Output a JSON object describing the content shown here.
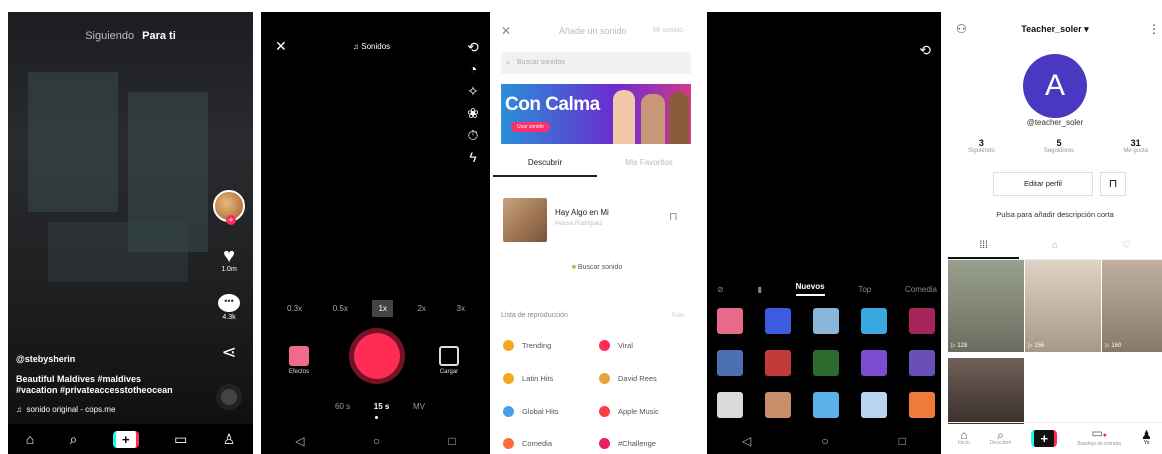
{
  "feed": {
    "tab_following": "Siguiendo",
    "tab_foryou": "Para ti",
    "likes": "1.0m",
    "comments": "4.3k",
    "username": "@stebysherin",
    "caption_line1": "Beautiful Maldives #maldives",
    "caption_line2": "#vacation #privateaccesstotheocean",
    "sound": "sonido original - cops.me"
  },
  "camera": {
    "sounds_label": "Sonidos",
    "speeds": [
      "0.3x",
      "0.5x",
      "1x",
      "2x",
      "3x"
    ],
    "selected_speed": "1x",
    "effects_label": "Efectos",
    "upload_label": "Cargar",
    "modes": [
      "60 s",
      "15 s",
      "MV"
    ],
    "selected_mode": "15 s"
  },
  "sounds": {
    "title": "Añade un sonido",
    "my_sounds": "Mi sonido",
    "search_placeholder": "Buscar sonidos",
    "banner_title": "Con Calma",
    "banner_button": "Usar sonido",
    "tab_discover": "Descubrir",
    "tab_favorites": "Mis Favoritos",
    "song_title": "Hay Algo en Mi",
    "song_artist": "Pelusa Rodriguez",
    "search_more": "Buscar sonido",
    "playlist_header": "Lista de reproducción",
    "playlist_all": "Todo",
    "playlists": [
      {
        "name": "Trending",
        "color": "#f5a623"
      },
      {
        "name": "Viral",
        "color": "#fe2c55"
      },
      {
        "name": "Latin Hits",
        "color": "#f5a623"
      },
      {
        "name": "David Rees",
        "color": "#e9a23b"
      },
      {
        "name": "Global Hits",
        "color": "#4a9fe8"
      },
      {
        "name": "Apple Music",
        "color": "#fc3c44"
      },
      {
        "name": "Comedia",
        "color": "#ff6b3d"
      },
      {
        "name": "#Challenge",
        "color": "#e91e63"
      }
    ]
  },
  "effects": {
    "tabs": [
      "Nuevos",
      "Top",
      "Comedia"
    ],
    "selected_tab": "Nuevos",
    "colors": [
      "#e86a8a",
      "#3d5be0",
      "#8ab6d9",
      "#3aa7e0",
      "#a5245a",
      "#4b6fb0",
      "#c23a3a",
      "#2d6a2d",
      "#7c4bd1",
      "#6b4fb8",
      "#d9d9d9",
      "#c98e6a",
      "#5ab0e8",
      "#b8d4f0",
      "#f07a3a"
    ]
  },
  "profile": {
    "username_title": "Teacher_soler",
    "initial": "A",
    "handle": "@teacher_soler",
    "following_count": "3",
    "following_label": "Siguiendo",
    "followers_count": "5",
    "followers_label": "Seguidores",
    "likes_count": "31",
    "likes_label": "Me gusta",
    "edit_label": "Editar perfil",
    "bio_prompt": "Pulsa para añadir descripción corta",
    "videos": [
      {
        "views": "▷ 128",
        "color": "#8a8f7a"
      },
      {
        "views": "▷ 156",
        "color": "#c9b8a8"
      },
      {
        "views": "▷ 160",
        "color": "#a89a8a"
      },
      {
        "views": "",
        "color": "#5a4e48"
      }
    ],
    "nav": [
      "Inicio",
      "Descubrir",
      "",
      "Bandeja de entrada",
      "Yo"
    ]
  }
}
